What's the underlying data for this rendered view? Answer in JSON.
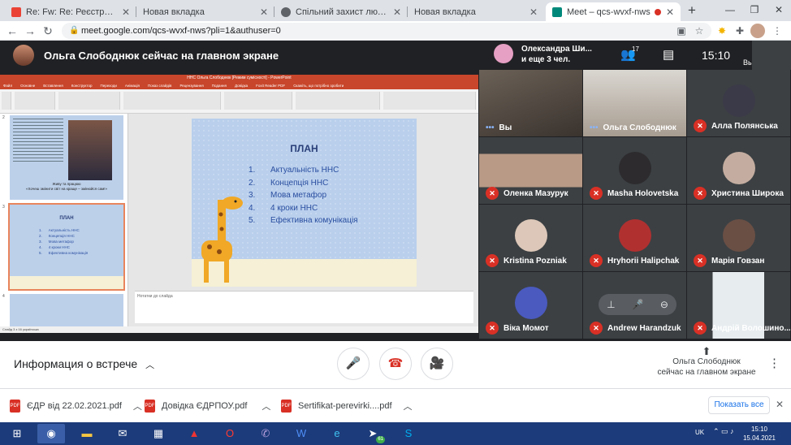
{
  "tabs": [
    {
      "title": "Re: Fw: Re: Реєстрація ОКД • ел.",
      "color": "#ea4335"
    },
    {
      "title": "Новая вкладка",
      "color": "#9aa0a6"
    },
    {
      "title": "Спільний захист людей та нав...",
      "color": "#5f6368"
    },
    {
      "title": "Новая вкладка",
      "color": "#9aa0a6"
    },
    {
      "title": "Meet – qcs-wvxf-nws",
      "color": "#00897b"
    }
  ],
  "address": {
    "url": "meet.google.com/qcs-wvxf-nws?pli=1&authuser=0"
  },
  "meet": {
    "presenting_text": "Ольга Слободнюк сейчас на главном экране",
    "participants_preview": "Олександра Ши...",
    "participants_more": "и еще 3 чел.",
    "participant_count": "17",
    "time": "15:10",
    "self_label": "Вы"
  },
  "ppt": {
    "title": "ННС Ольга Слободнюк [Режим сумісності] - PowerPoint",
    "menu": [
      "Файл",
      "Основне",
      "Вставлення",
      "Конструктор",
      "Переходи",
      "Анімація",
      "Показ слайдів",
      "Рецензування",
      "Подання",
      "Довідка",
      "Foxit Reader PDF",
      "Скажіть, що потрібно зробити"
    ],
    "thumb1_caption_1": "Живу та працюю",
    "thumb1_caption_2": "«Хочеш змінити світ на краще – змінюйся сам!»",
    "thumb2_title": "ПЛАН",
    "slide_nums": [
      "2",
      "3",
      "4"
    ],
    "notes_placeholder": "Нотатки до слайда",
    "status": "Слайд 3 з 16   українська"
  },
  "slide": {
    "title": "ПЛАН",
    "items": [
      {
        "n": "1.",
        "t": "Актуальність ННС"
      },
      {
        "n": "2.",
        "t": "Концепція ННС"
      },
      {
        "n": "3.",
        "t": "Мова метафор"
      },
      {
        "n": "4.",
        "t": "4 кроки ННС"
      },
      {
        "n": "5.",
        "t": "Ефективна комунікація"
      }
    ]
  },
  "participants": [
    {
      "name": "Вы",
      "muted": false
    },
    {
      "name": "Ольга Слободнюк",
      "muted": false
    },
    {
      "name": "Алла Полянська",
      "muted": true
    },
    {
      "name": "Оленка Мазурук",
      "muted": true
    },
    {
      "name": "Masha Holovetska",
      "muted": true
    },
    {
      "name": "Христина Широка",
      "muted": true
    },
    {
      "name": "Kristina Pozniak",
      "muted": true
    },
    {
      "name": "Hryhorii Halipchak",
      "muted": true
    },
    {
      "name": "Марія Говзан",
      "muted": true
    },
    {
      "name": "Віка Момот",
      "muted": true
    },
    {
      "name": "Andrew Harandzuk",
      "muted": true
    },
    {
      "name": "Андрій Волошино...",
      "muted": true
    }
  ],
  "bottom": {
    "meeting_info": "Информация о встрече",
    "presenter_line1": "Ольга Слободнюк",
    "presenter_line2": "сейчас на главном экране"
  },
  "downloads": [
    {
      "name": "ЄДР від 22.02.2021.pdf"
    },
    {
      "name": "Довідка ЄДРПОУ.pdf"
    },
    {
      "name": "Sertifikat-perevirki....pdf"
    }
  ],
  "show_all": "Показать все",
  "taskbar": {
    "lang": "UK",
    "time": "15:10",
    "date": "15.04.2021",
    "badge": "61"
  }
}
